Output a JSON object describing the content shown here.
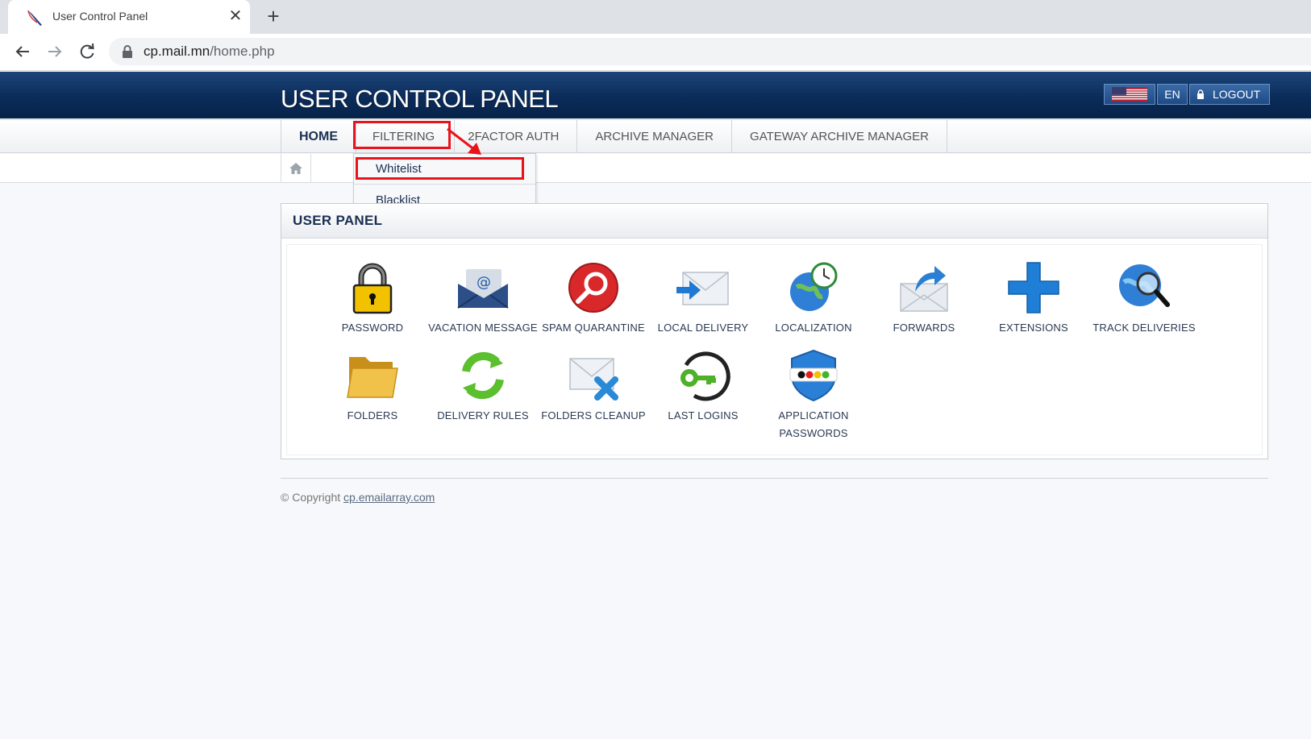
{
  "browser": {
    "tab_title": "User Control Panel",
    "url_host": "cp.mail.mn",
    "url_path": "/home.php"
  },
  "header": {
    "title": "USER CONTROL PANEL",
    "lang": "EN",
    "logout": "LOGOUT"
  },
  "nav": {
    "items": [
      {
        "label": "HOME"
      },
      {
        "label": "FILTERING"
      },
      {
        "label": "2FACTOR AUTH"
      },
      {
        "label": "ARCHIVE MANAGER"
      },
      {
        "label": "GATEWAY ARCHIVE MANAGER"
      }
    ],
    "dropdown": [
      {
        "label": "Whitelist"
      },
      {
        "label": "Blacklist"
      }
    ]
  },
  "panel": {
    "title": "USER PANEL",
    "tiles": [
      {
        "label": "PASSWORD",
        "icon": "padlock-icon"
      },
      {
        "label": "VACATION MESSAGE",
        "icon": "vacation-mail-icon"
      },
      {
        "label": "SPAM QUARANTINE",
        "icon": "spam-quarantine-icon"
      },
      {
        "label": "LOCAL DELIVERY",
        "icon": "local-delivery-icon"
      },
      {
        "label": "LOCALIZATION",
        "icon": "globe-clock-icon"
      },
      {
        "label": "FORWARDS",
        "icon": "forward-mail-icon"
      },
      {
        "label": "EXTENSIONS",
        "icon": "plus-icon"
      },
      {
        "label": "TRACK DELIVERIES",
        "icon": "globe-search-icon"
      },
      {
        "label": "FOLDERS",
        "icon": "folder-icon"
      },
      {
        "label": "DELIVERY RULES",
        "icon": "recycle-arrows-icon"
      },
      {
        "label": "FOLDERS CLEANUP",
        "icon": "mail-delete-icon"
      },
      {
        "label": "LAST LOGINS",
        "icon": "key-icon"
      },
      {
        "label": "APPLICATION",
        "label2": "PASSWORDS",
        "icon": "shield-password-icon"
      }
    ]
  },
  "footer": {
    "copyright": "© Copyright ",
    "link": "cp.emailarray.com"
  },
  "colors": {
    "header_blue": "#0b2c5a",
    "annotation_red": "#e8141c",
    "text_dark": "#1a2f52"
  }
}
